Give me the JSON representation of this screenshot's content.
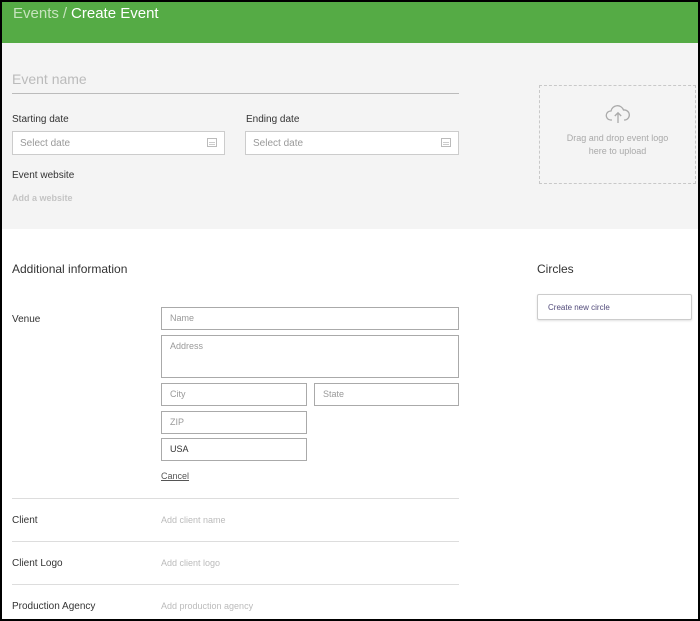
{
  "header": {
    "breadcrumb_parent": "Events",
    "breadcrumb_sep": "/",
    "title": "Create Event"
  },
  "event": {
    "name_placeholder": "Event name",
    "starting_date_label": "Starting date",
    "starting_date_placeholder": "Select date",
    "ending_date_label": "Ending date",
    "ending_date_placeholder": "Select date",
    "website_label": "Event website",
    "website_placeholder": "Add a website",
    "logo_drop_text": "Drag and drop event logo here to upload"
  },
  "additional": {
    "title": "Additional information",
    "venue_label": "Venue",
    "venue_name_placeholder": "Name",
    "venue_address_placeholder": "Address",
    "venue_city_placeholder": "City",
    "venue_state_placeholder": "State",
    "venue_zip_placeholder": "ZIP",
    "venue_country_value": "USA",
    "cancel_label": "Cancel",
    "client_label": "Client",
    "client_placeholder": "Add client name",
    "client_logo_label": "Client Logo",
    "client_logo_placeholder": "Add client logo",
    "agency_label": "Production Agency",
    "agency_placeholder": "Add production agency"
  },
  "circles": {
    "title": "Circles",
    "create_label": "Create new circle"
  },
  "colors": {
    "header_green": "#55ab45",
    "panel_gray": "#f4f4f4",
    "accent_purple": "#514a7a"
  }
}
